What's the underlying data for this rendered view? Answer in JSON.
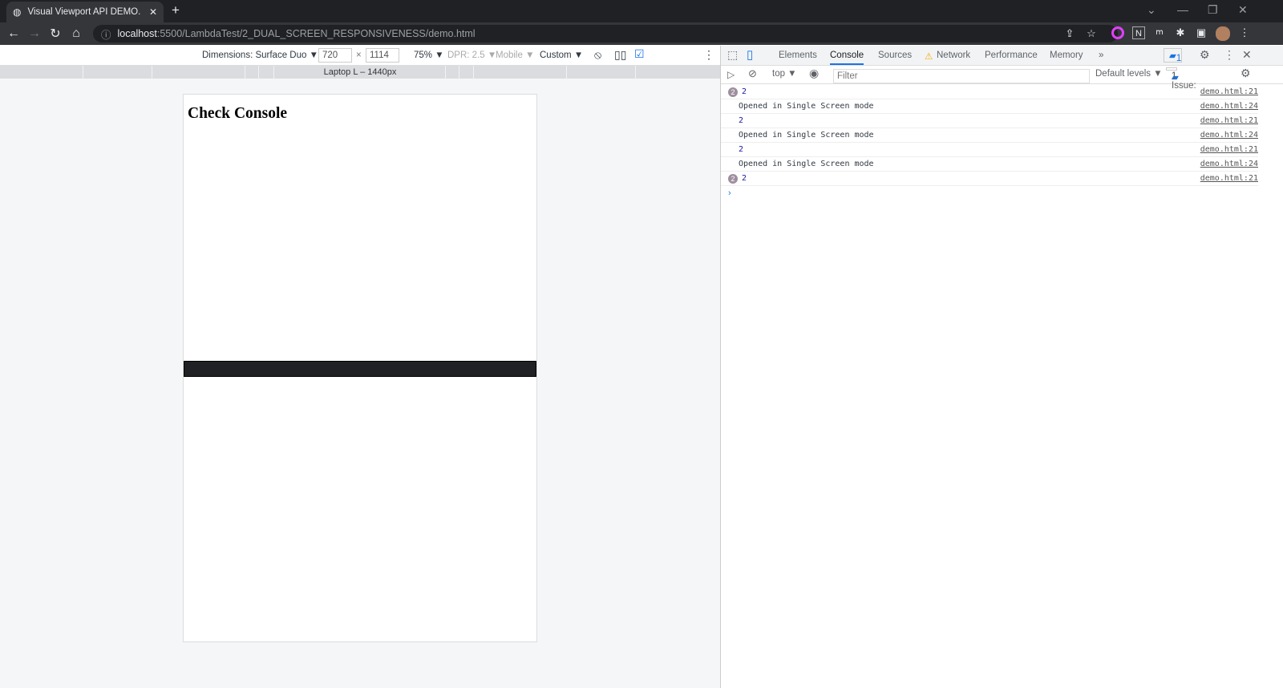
{
  "browser": {
    "tab_title": "Visual Viewport API DEMO.",
    "url_host": "localhost",
    "url_rest": ":5500/LambdaTest/2_DUAL_SCREEN_RESPONSIVENESS/demo.html"
  },
  "device_toolbar": {
    "dimensions": "Dimensions: Surface Duo ▼",
    "width": "720",
    "x": "×",
    "height": "1114",
    "zoom": "75% ▼",
    "dpr": "DPR: 2.5 ▼",
    "mobile": "Mobile ▼",
    "custom": "Custom ▼",
    "ruler_label": "Laptop L – 1440px"
  },
  "page": {
    "heading": "Check Console"
  },
  "devtools": {
    "tabs": [
      "Elements",
      "Console",
      "Sources",
      "Network",
      "Performance",
      "Memory"
    ],
    "active_tab": "Console",
    "issues_badge": "1",
    "context": "top ▼",
    "filter_placeholder": "Filter",
    "levels": "Default levels ▼",
    "issues_text": "1 Issue:",
    "issues_count": "1",
    "messages": [
      {
        "text": "2",
        "count": "2",
        "source": "demo.html:21"
      },
      {
        "text": "Opened in Single Screen mode",
        "source": "demo.html:24"
      },
      {
        "text": "2",
        "source": "demo.html:21"
      },
      {
        "text": "Opened in Single Screen mode",
        "source": "demo.html:24"
      },
      {
        "text": "2",
        "source": "demo.html:21"
      },
      {
        "text": "Opened in Single Screen mode",
        "source": "demo.html:24"
      },
      {
        "text": "2",
        "count": "2",
        "source": "demo.html:21"
      }
    ]
  },
  "colors": {
    "accent": "#1a73e8",
    "chrome_dark": "#202124"
  }
}
